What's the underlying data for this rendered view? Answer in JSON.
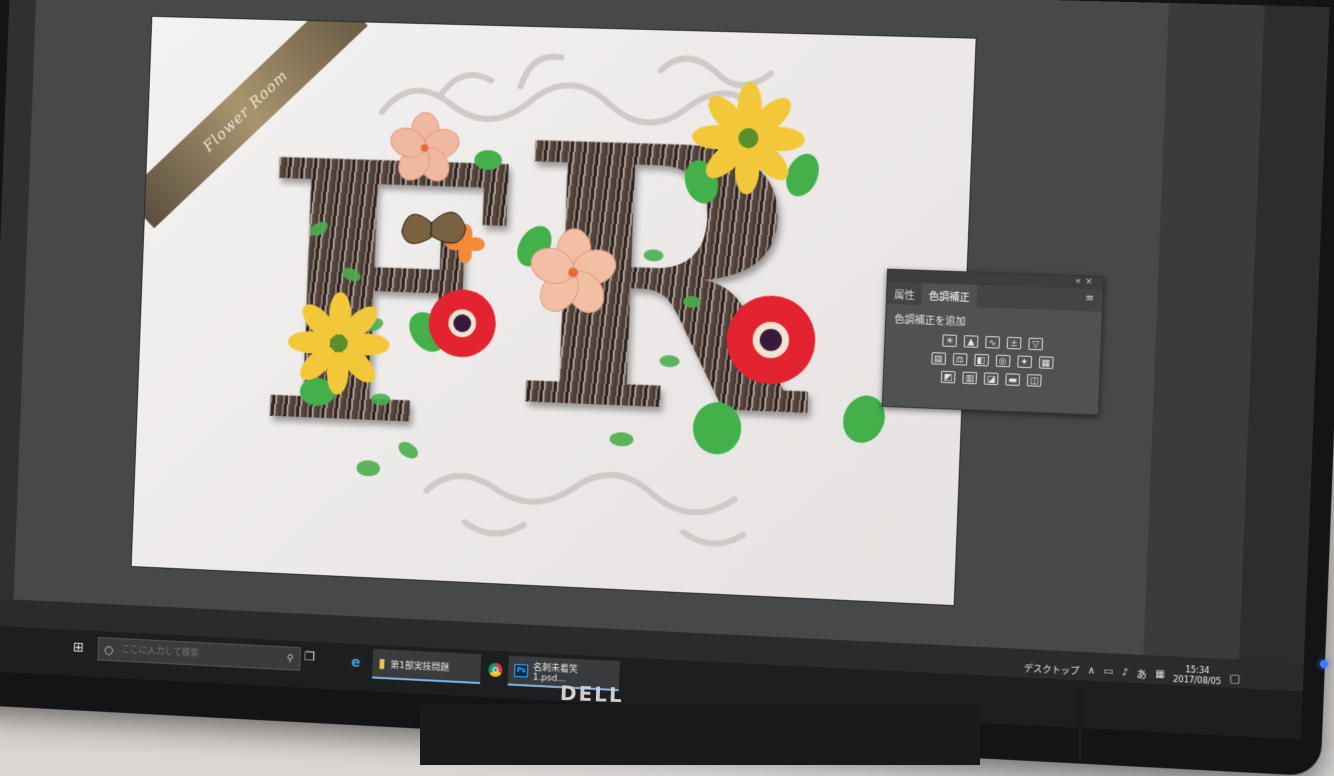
{
  "artwork": {
    "ribbon_text": "Flower Room",
    "letters": [
      "F",
      "R"
    ]
  },
  "adjustments_panel": {
    "tab_properties": "属性",
    "tab_adjustments": "色調補正",
    "add_label": "色調補正を追加",
    "icon_rows": [
      [
        "brightness-contrast-icon",
        "levels-icon",
        "curves-icon",
        "exposure-icon",
        "vibrance-icon"
      ],
      [
        "hue-saturation-icon",
        "color-balance-icon",
        "black-white-icon",
        "photo-filter-icon",
        "channel-mixer-icon",
        "color-lookup-icon"
      ],
      [
        "invert-icon",
        "posterize-icon",
        "threshold-icon",
        "gradient-map-icon",
        "selective-color-icon"
      ]
    ]
  },
  "taskbar": {
    "search_placeholder": "ここに入力して検索",
    "apps": [
      {
        "name": "edge",
        "label": ""
      },
      {
        "name": "explorer",
        "label": "第1部実技問題"
      },
      {
        "name": "chrome",
        "label": ""
      },
      {
        "name": "photoshop",
        "label": "名刺未着笑 1.psd..."
      }
    ],
    "tray": {
      "desktop_label": "デスクトップ",
      "time": "15:34",
      "date": "2017/08/05"
    }
  },
  "monitor": {
    "brand": "DELL"
  },
  "colors": {
    "ps_workspace": "#47484a",
    "panel": "#505153",
    "taskbar": "#1d1e20",
    "accent": "#7fb6e8"
  }
}
